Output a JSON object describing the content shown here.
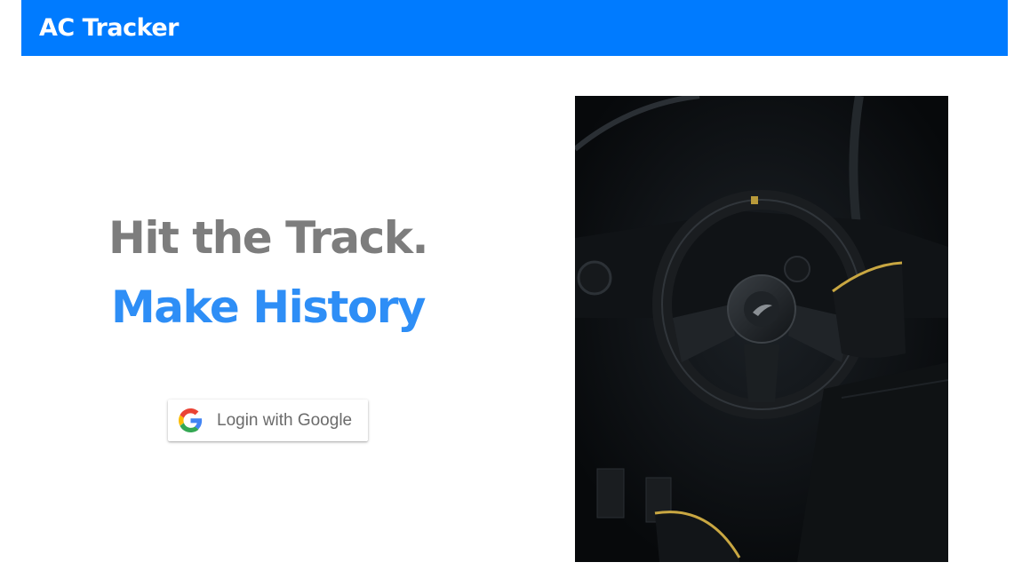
{
  "navbar": {
    "brand": "AC Tracker"
  },
  "hero": {
    "headline_line1": "Hit the Track.",
    "headline_line2": "Make History",
    "login_button": {
      "label": "Login with Google",
      "icon": "google-g-icon"
    },
    "image": {
      "subject": "race car cockpit steering wheel"
    }
  },
  "colors": {
    "navbar_bg": "#007bff",
    "headline_gray": "#7d7d7d",
    "headline_blue": "#2e8ef6",
    "button_text": "#6b6b6b"
  }
}
